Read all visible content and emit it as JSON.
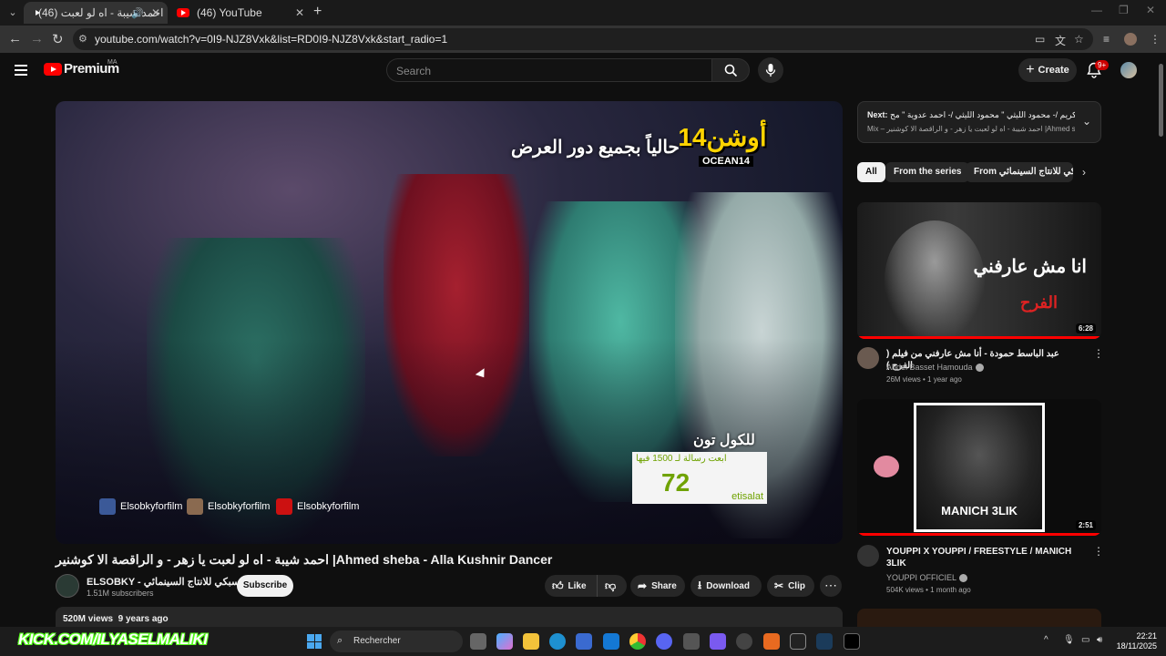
{
  "browser": {
    "tabs": [
      {
        "title": "احمد شيبة - اه لو لعبت (46)",
        "active": true
      },
      {
        "title": "(46) YouTube",
        "active": false
      }
    ],
    "url": "youtube.com/watch?v=0I9-NJZ8Vxk&list=RD0I9-NJZ8Vxk&start_radio=1"
  },
  "header": {
    "logo": "Premium",
    "country": "MA",
    "search_placeholder": "Search",
    "create_label": "Create",
    "notif_badge": "9+"
  },
  "video": {
    "overlay_tagline": "حالياً بجميع دور العرض",
    "overlay_movie": "أوشن14",
    "overlay_movie_latin": "OCEAN14",
    "promo_heading": "للكول تون",
    "promo_small": "ابعت رسالة لـ 1500 فيها",
    "promo_number": "72",
    "promo_brand": "etisalat",
    "social": [
      {
        "name": "Elsobkyforfilm",
        "icon": "facebook-icon"
      },
      {
        "name": "Elsobkyforfilm",
        "icon": "instagram-icon"
      },
      {
        "name": "Elsobkyforfilm",
        "icon": "youtube-icon"
      }
    ],
    "title": "احمد شيبة - اه لو لعبت يا زهر - و الراقصة الا كوشنير |Ahmed sheba - Alla Kushnir Dancer",
    "channel": "ELSOBKY - السبكي للانتاج السينمائي",
    "subscribers": "1.51M subscribers",
    "subscribe_label": "Subscribe",
    "like_label": "Like",
    "share_label": "Share",
    "download_label": "Download",
    "clip_label": "Clip",
    "views": "520M views",
    "age": "9 years ago"
  },
  "sidebar": {
    "next_label": "Next:",
    "next_title": "مسلسل رمضان كريم /- محمود الليثي \" محمود الليثي /- احمد عدوية \" مح",
    "next_sub": "Mix – احمد شيبة - اه لو لعبت يا زهر - و الراقصة الا كوشنير |Ahmed sheba ...",
    "chips": [
      "All",
      "From the series",
      "From السبكي للانتاج السينمائي"
    ],
    "recs": [
      {
        "title": "عبد الباسط حمودة - أنا مش عارفني من فيلم ( الفرح )",
        "channel": "Abdel Basset Hamouda",
        "views": "26M views",
        "age": "1 year ago",
        "duration": "6:28",
        "thumb_text": "انا مش عارفني",
        "thumb_sub": "الفرح",
        "progress": 1.0
      },
      {
        "title": "YOUPPI X YOUPPI / FREESTYLE / MANICH 3LIK",
        "channel": "YOUPPI OFFICIEL",
        "views": "504K views",
        "age": "1 month ago",
        "duration": "2:51",
        "thumb_text": "MANICH 3LIK",
        "progress": 1.0
      }
    ]
  },
  "taskbar": {
    "kick_text": "KICK.COM/ILYASELMALIKI",
    "search_placeholder": "Rechercher",
    "time": "22:21",
    "date": "18/11/2025"
  }
}
